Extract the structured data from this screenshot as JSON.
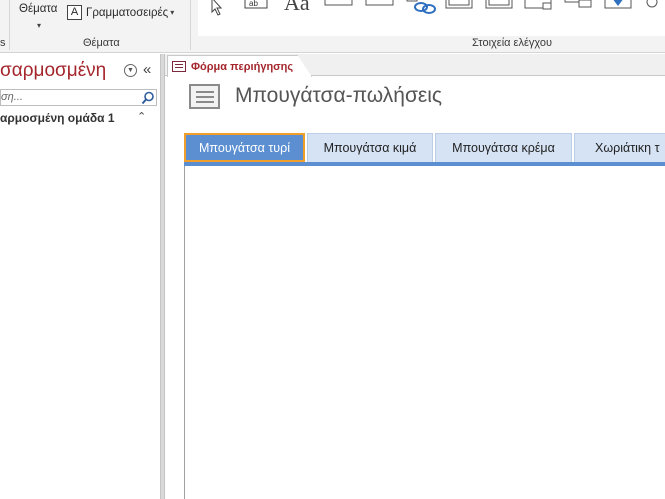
{
  "ribbon": {
    "themes_button": "Θέματα",
    "fonts_button": "Γραμματοσειρές",
    "fonts_icon_letter": "A",
    "themes_group_label": "Θέματα",
    "controls_group_label": "Στοιχεία ελέγχου",
    "controls_partial_text": "Aa"
  },
  "nav_pane": {
    "title": "σαρμοσμένη",
    "search_placeholder": "ση...",
    "group": "αρμοσμένη ομάδα 1"
  },
  "document": {
    "tab_label": "Φόρμα περιήγησης",
    "form_title": "Μπουγάτσα-πωλήσεις",
    "nav_tabs": [
      {
        "label": "Μπουγάτσα τυρί",
        "selected": true
      },
      {
        "label": "Μπουγάτσα κιμά",
        "selected": false
      },
      {
        "label": "Μπουγάτσα κρέμα",
        "selected": false
      },
      {
        "label": "Χωριάτικη τ",
        "selected": false
      }
    ]
  },
  "colors": {
    "accent_red": "#a4262c",
    "tab_selected": "#5b8fd1",
    "tab_focus_border": "#f0a02a",
    "tab_unselected": "#d6e3f4"
  }
}
